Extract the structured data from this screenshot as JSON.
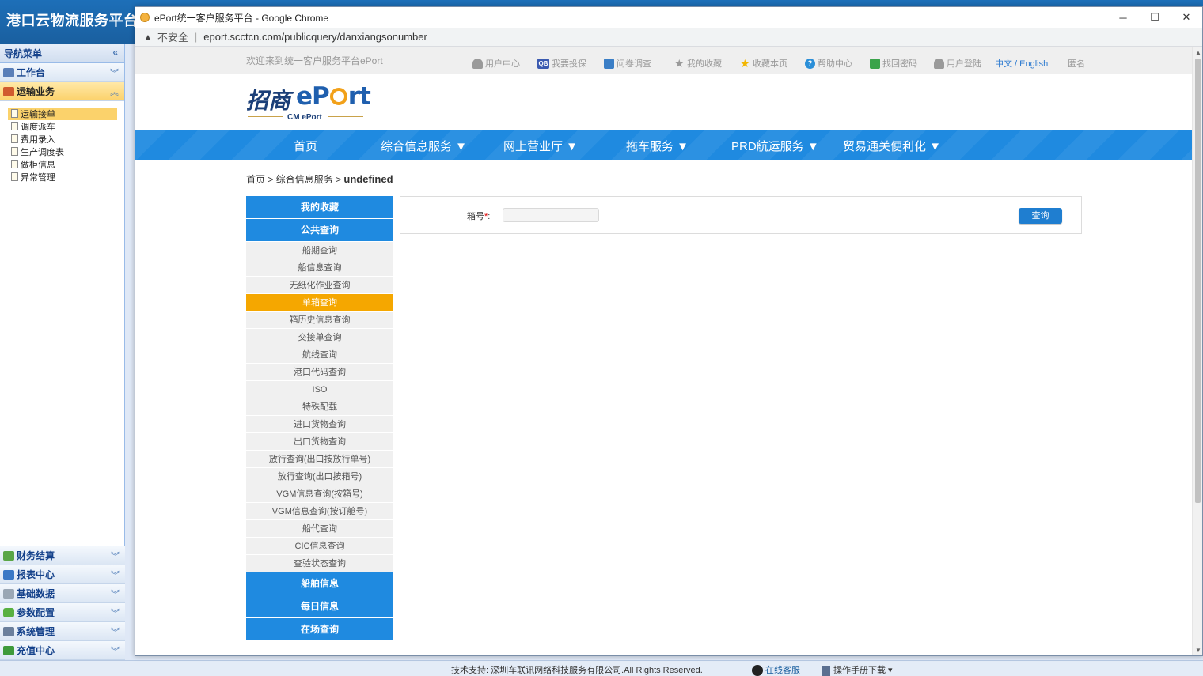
{
  "host": {
    "title": "港口云物流服务平台",
    "nav_menu_label": "导航菜单",
    "workbench_label": "工作台",
    "transport_label": "运输业务",
    "transport_items": [
      "运输接单",
      "调度派车",
      "费用录入",
      "生产调度表",
      "做柜信息",
      "异常管理"
    ],
    "bottom_sections": [
      "财务结算",
      "报表中心",
      "基础数据",
      "参数配置",
      "系统管理",
      "充值中心"
    ],
    "status_tech": "技术支持:   深圳车联讯网络科技服务有限公司.All Rights Reserved.",
    "status_kefu": "在线客服",
    "status_manual": "操作手册下载 ▾"
  },
  "browser": {
    "window_title": "ePort统一客户服务平台 - Google Chrome",
    "insecure_label": "不安全",
    "url": "eport.scctcn.com/publicquery/danxiangsonumber",
    "controls": {
      "minimize": "─",
      "maximize": "☐",
      "close": "✕"
    }
  },
  "page": {
    "welcome": "欢迎来到统一客户服务平台ePort",
    "toplinks": [
      "用户中心",
      "我要投保",
      "问卷调查",
      "我的收藏",
      "收藏本页",
      "帮助中心",
      "找回密码",
      "用户登陆",
      "中文 / English",
      "匿名"
    ],
    "logo": {
      "cn": "招商",
      "ep_before": "eP",
      "ep_after": "rt",
      "sub": "CM ePort"
    },
    "nav": [
      "首页",
      "综合信息服务 ▼",
      "网上营业厅 ▼",
      "拖车服务 ▼",
      "PRD航运服务 ▼",
      "贸易通关便利化 ▼"
    ],
    "breadcrumb": {
      "home": "首页",
      "sep1": " > ",
      "section": "综合信息服务",
      "sep2": " > ",
      "current": "undefined"
    },
    "menu": {
      "favorites": "我的收藏",
      "public_query": "公共查询",
      "items": [
        "船期查询",
        "船信息查询",
        "无纸化作业查询",
        "单箱查询",
        "箱历史信息查询",
        "交接单查询",
        "航线查询",
        "港口代码查询",
        "ISO",
        "特殊配载",
        "进口货物查询",
        "出口货物查询",
        "放行查询(出口按放行单号)",
        "放行查询(出口按箱号)",
        "VGM信息查询(按箱号)",
        "VGM信息查询(按订舱号)",
        "船代查询",
        "CIC信息查询",
        "查验状态查询"
      ],
      "selected_item": "单箱查询",
      "ship_info": "船舶信息",
      "daily_info": "每日信息",
      "yard_query": "在场查询"
    },
    "query": {
      "label": "箱号",
      "required_mark": "*",
      "colon": ":",
      "value": "",
      "button": "查询"
    }
  }
}
